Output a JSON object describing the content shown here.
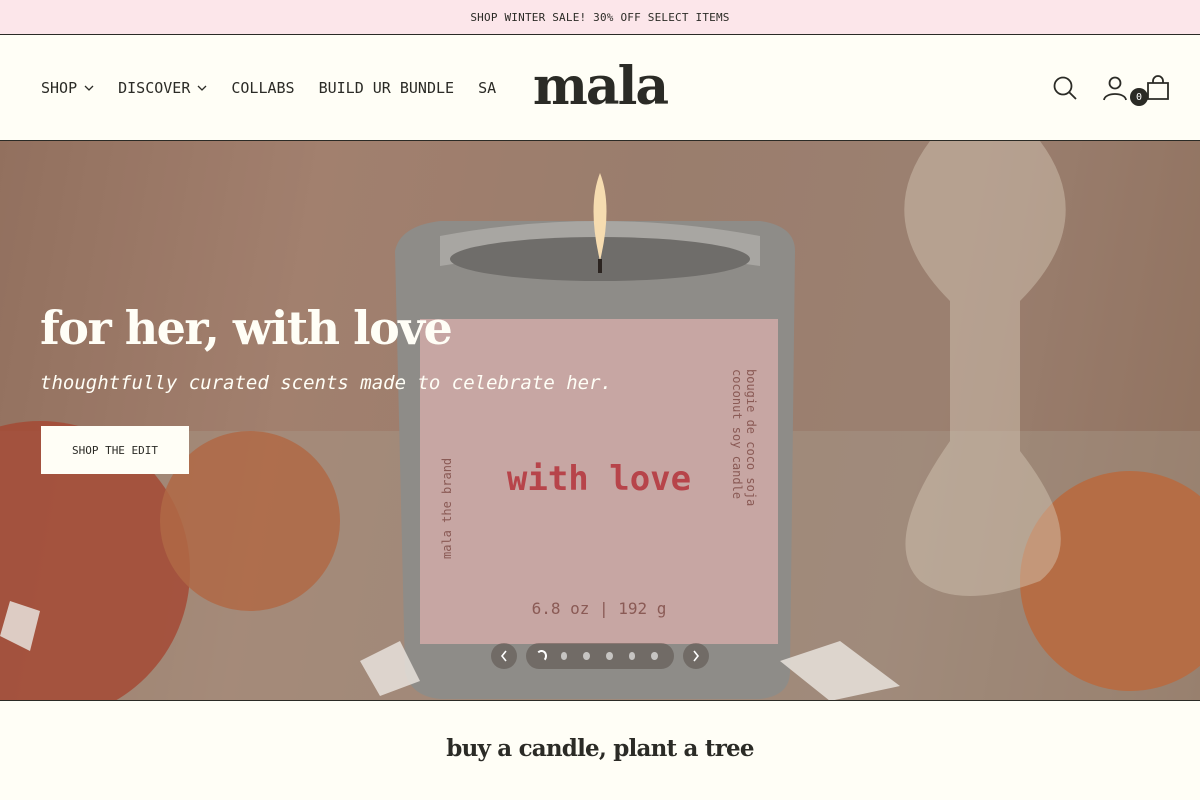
{
  "announcement": {
    "text": "SHOP WINTER SALE! 30% OFF SELECT ITEMS"
  },
  "header": {
    "logo": "mala",
    "nav": [
      {
        "label": "SHOP",
        "has_dropdown": true
      },
      {
        "label": "DISCOVER",
        "has_dropdown": true
      },
      {
        "label": "COLLABS",
        "has_dropdown": false
      },
      {
        "label": "BUILD UR BUNDLE",
        "has_dropdown": false
      },
      {
        "label": "SA",
        "has_dropdown": false
      }
    ],
    "icons": [
      "search-icon",
      "account-icon",
      "cart-icon"
    ],
    "cart_count": "0"
  },
  "hero": {
    "title": "for her, with love",
    "subtitle": "thoughtfully curated scents made to celebrate her.",
    "cta_label": "SHOP THE EDIT",
    "candle_label": {
      "main": "with love",
      "side_left": "mala the brand",
      "side_right_1": "coconut soy candle",
      "side_right_2": "bougie de coco soja",
      "size": "6.8 oz | 192 g"
    },
    "slides_total": 6,
    "active_slide": 1
  },
  "section": {
    "title": "buy a candle, plant a tree"
  },
  "colors": {
    "announcement_bg": "#fce6ea",
    "page_bg": "#fffef6",
    "text": "#2b2b26",
    "label_red": "#c0454a"
  }
}
